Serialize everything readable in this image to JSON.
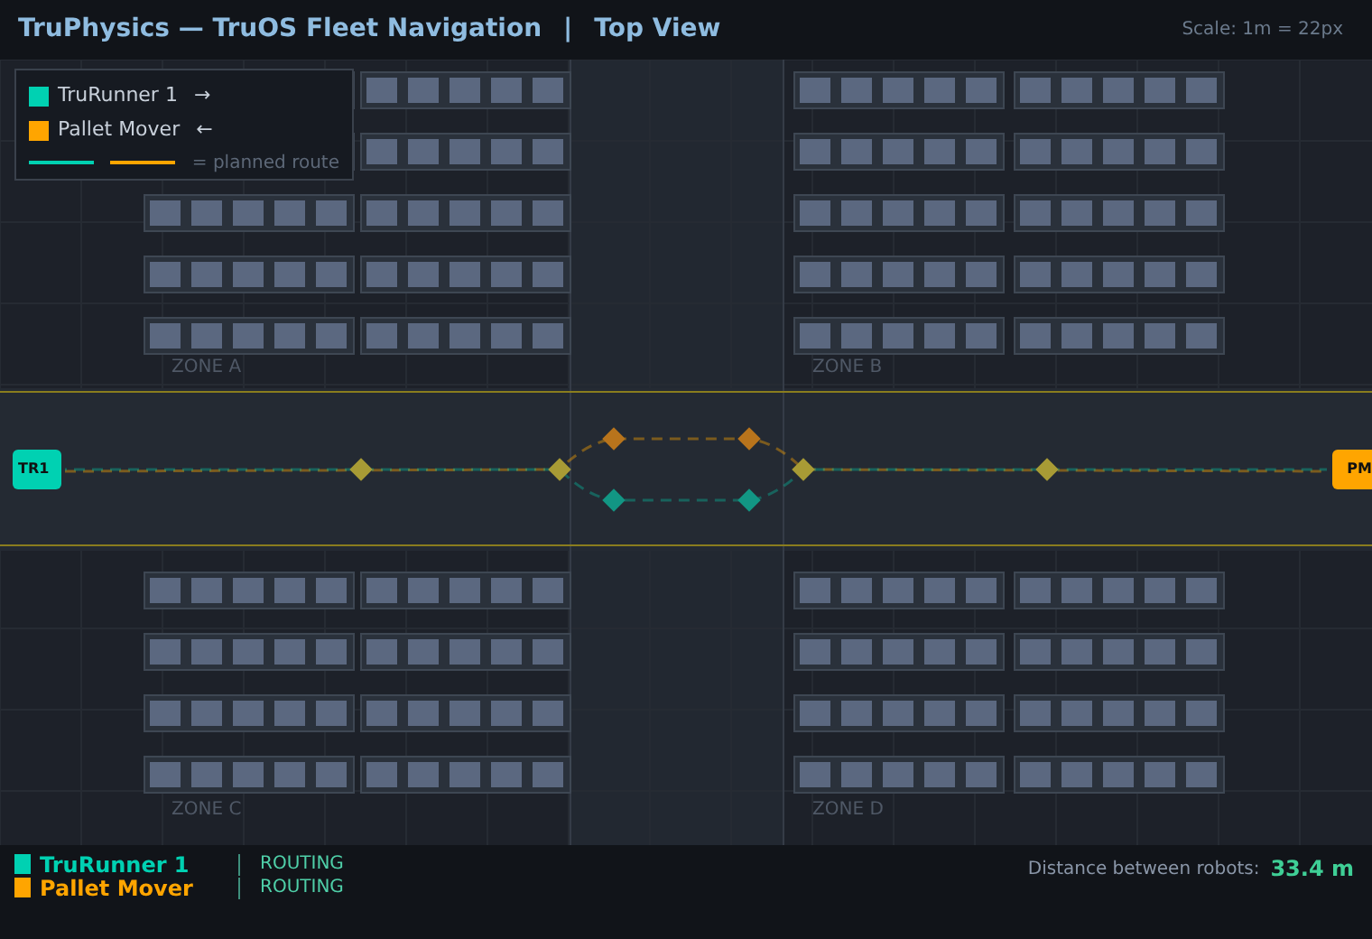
{
  "header": {
    "title": "TruPhysics — TruOS Fleet Navigation",
    "separator": "|",
    "view": "Top View",
    "scale": "Scale: 1m = 22px"
  },
  "legend": {
    "robots": [
      {
        "name": "TruRunner 1",
        "arrow": "→",
        "color": "#00d1b2"
      },
      {
        "name": "Pallet Mover",
        "arrow": "←",
        "color": "#ffa500"
      }
    ],
    "route_note": "= planned route"
  },
  "zones": [
    "ZONE A",
    "ZONE B",
    "ZONE C",
    "ZONE D"
  ],
  "robots": [
    {
      "label": "TR1",
      "kind": "start",
      "color": "#00d1b2"
    },
    {
      "label": "PM",
      "kind": "end",
      "color": "#ffa500"
    }
  ],
  "status": {
    "robots": [
      {
        "name": "TruRunner 1",
        "state": "ROUTING",
        "color": "#00d1b2"
      },
      {
        "name": "Pallet Mover",
        "state": "ROUTING",
        "color": "#ffa500"
      }
    ],
    "distance_label": "Distance between robots:",
    "distance": "33.4 m"
  }
}
